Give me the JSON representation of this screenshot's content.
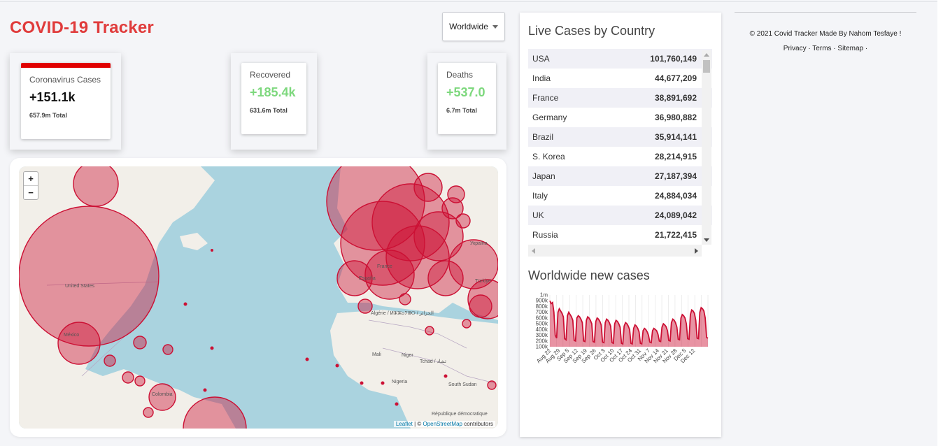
{
  "header": {
    "title": "COVID-19 Tracker",
    "country_select": "Worldwide"
  },
  "info_boxes": [
    {
      "label": "Coronavirus Cases",
      "value": "+151.1k",
      "total": "657.9m Total",
      "color": "#111111"
    },
    {
      "label": "Recovered",
      "value": "+185.4k",
      "total": "631.6m Total",
      "color": "#7dd87d"
    },
    {
      "label": "Deaths",
      "value": "+537.0",
      "total": "6.7m Total",
      "color": "#7dd87d"
    }
  ],
  "map": {
    "zoom_in": "+",
    "zoom_out": "−",
    "labels": [
      "United States",
      "México",
      "Colombia",
      "Algérie / ⵍⵣⵣⴰⵢⴻⵔ / الجزائر",
      "Mali",
      "Niger",
      "Tchad / تشاد",
      "Nigeria",
      "South Sudan",
      "République démocratique",
      "España",
      "Україна",
      "Türkiye",
      "France"
    ],
    "attribution": {
      "leaflet": "Leaflet",
      "sep": " | © ",
      "osm": "OpenStreetMap",
      "rest": " contributors"
    }
  },
  "right_panel": {
    "table_title": "Live Cases by Country",
    "countries": [
      {
        "name": "USA",
        "cases": "101,760,149"
      },
      {
        "name": "India",
        "cases": "44,677,209"
      },
      {
        "name": "France",
        "cases": "38,891,692"
      },
      {
        "name": "Germany",
        "cases": "36,980,882"
      },
      {
        "name": "Brazil",
        "cases": "35,914,141"
      },
      {
        "name": "S. Korea",
        "cases": "28,214,915"
      },
      {
        "name": "Japan",
        "cases": "27,187,394"
      },
      {
        "name": "Italy",
        "cases": "24,884,034"
      },
      {
        "name": "UK",
        "cases": "24,089,042"
      },
      {
        "name": "Russia",
        "cases": "21,722,415"
      }
    ],
    "graph_title": "Worldwide new cases"
  },
  "footer": {
    "copyright": "© 2021 Covid Tracker Made By Nahom Tesfaye !",
    "links": [
      "Privacy",
      "Terms",
      "Sitemap"
    ]
  },
  "chart_data": {
    "type": "area",
    "title": "",
    "color": "#cc1034",
    "y_ticks": [
      "100k",
      "200k",
      "300k",
      "400k",
      "500k",
      "600k",
      "700k",
      "800k",
      "900k",
      "1m"
    ],
    "x_ticks": [
      "Aug 22",
      "Aug 29",
      "Sep 5",
      "Sep 12",
      "Sep 19",
      "Sep 26",
      "Oct 3",
      "Oct 10",
      "Oct 17",
      "Oct 24",
      "Oct 31",
      "Nov 7",
      "Nov 14",
      "Nov 21",
      "Nov 28",
      "Dec 5",
      "Dec 12"
    ],
    "ylim": [
      100000,
      1000000
    ],
    "values": [
      900000,
      850000,
      870000,
      700000,
      300000,
      250000,
      700000,
      760000,
      720000,
      680000,
      620000,
      240000,
      220000,
      640000,
      700000,
      660000,
      620000,
      560000,
      210000,
      200000,
      600000,
      640000,
      620000,
      580000,
      520000,
      200000,
      190000,
      560000,
      620000,
      600000,
      560000,
      500000,
      190000,
      180000,
      540000,
      600000,
      580000,
      540000,
      480000,
      180000,
      170000,
      520000,
      580000,
      560000,
      520000,
      460000,
      170000,
      160000,
      500000,
      560000,
      540000,
      500000,
      440000,
      160000,
      150000,
      460000,
      520000,
      500000,
      460000,
      400000,
      160000,
      150000,
      420000,
      480000,
      460000,
      420000,
      360000,
      160000,
      150000,
      380000,
      420000,
      400000,
      360000,
      300000,
      180000,
      170000,
      380000,
      420000,
      400000,
      380000,
      320000,
      200000,
      190000,
      440000,
      500000,
      480000,
      450000,
      380000,
      210000,
      200000,
      520000,
      580000,
      560000,
      520000,
      440000,
      230000,
      220000,
      600000,
      660000,
      640000,
      600000,
      500000,
      240000,
      230000,
      660000,
      740000,
      720000,
      680000,
      560000,
      250000,
      240000,
      700000,
      780000,
      760000,
      720000,
      600000,
      260000,
      250000
    ]
  }
}
